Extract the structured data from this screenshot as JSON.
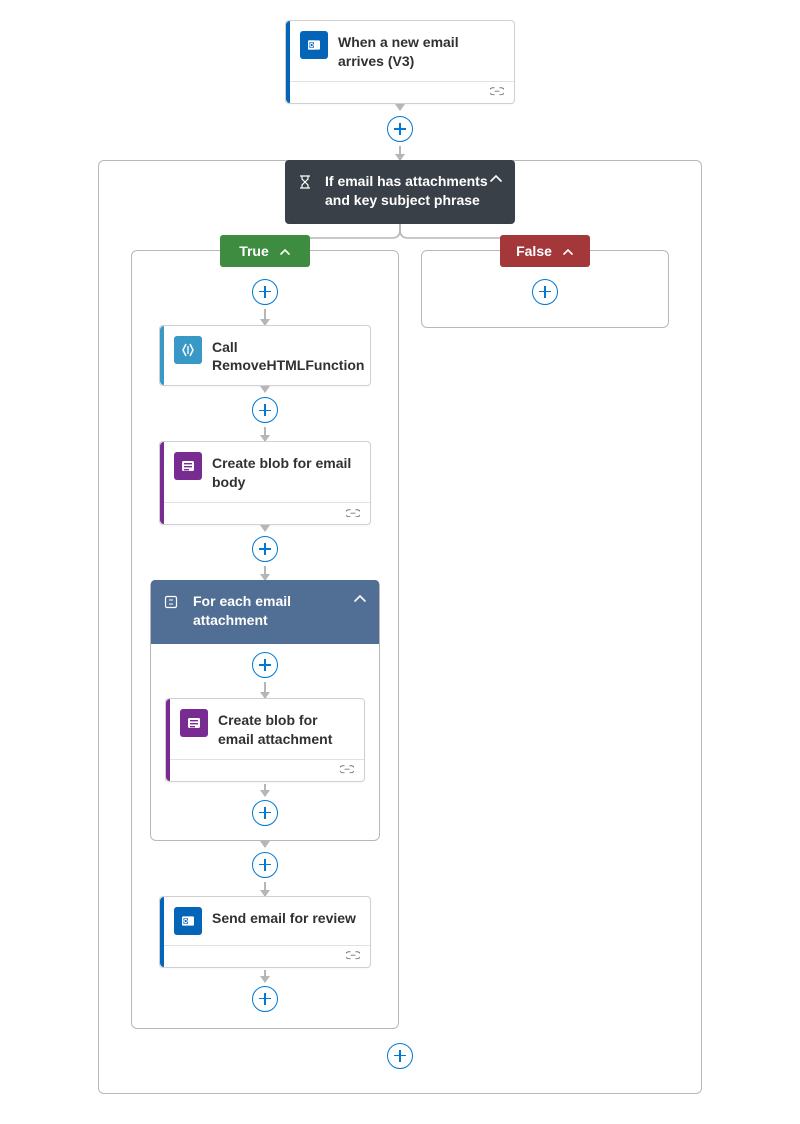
{
  "trigger": {
    "title": "When a new email arrives (V3)"
  },
  "condition": {
    "title": "If email has attachments and key subject phrase",
    "branches": {
      "true_label": "True",
      "false_label": "False"
    }
  },
  "true_branch": {
    "step1": {
      "title": "Call RemoveHTMLFunction"
    },
    "step2": {
      "title": "Create blob for email body"
    },
    "foreach": {
      "title": "For each email attachment",
      "inner_step": {
        "title": "Create blob for email attachment"
      }
    },
    "step4": {
      "title": "Send email for review"
    }
  },
  "colors": {
    "outlook": "#0364b8",
    "functions": "#3999c6",
    "blob": "#782b90",
    "condition": "#3a4047",
    "foreach": "#516f94",
    "true": "#3d8c40",
    "false": "#a4373a",
    "plus": "#0078d4"
  }
}
